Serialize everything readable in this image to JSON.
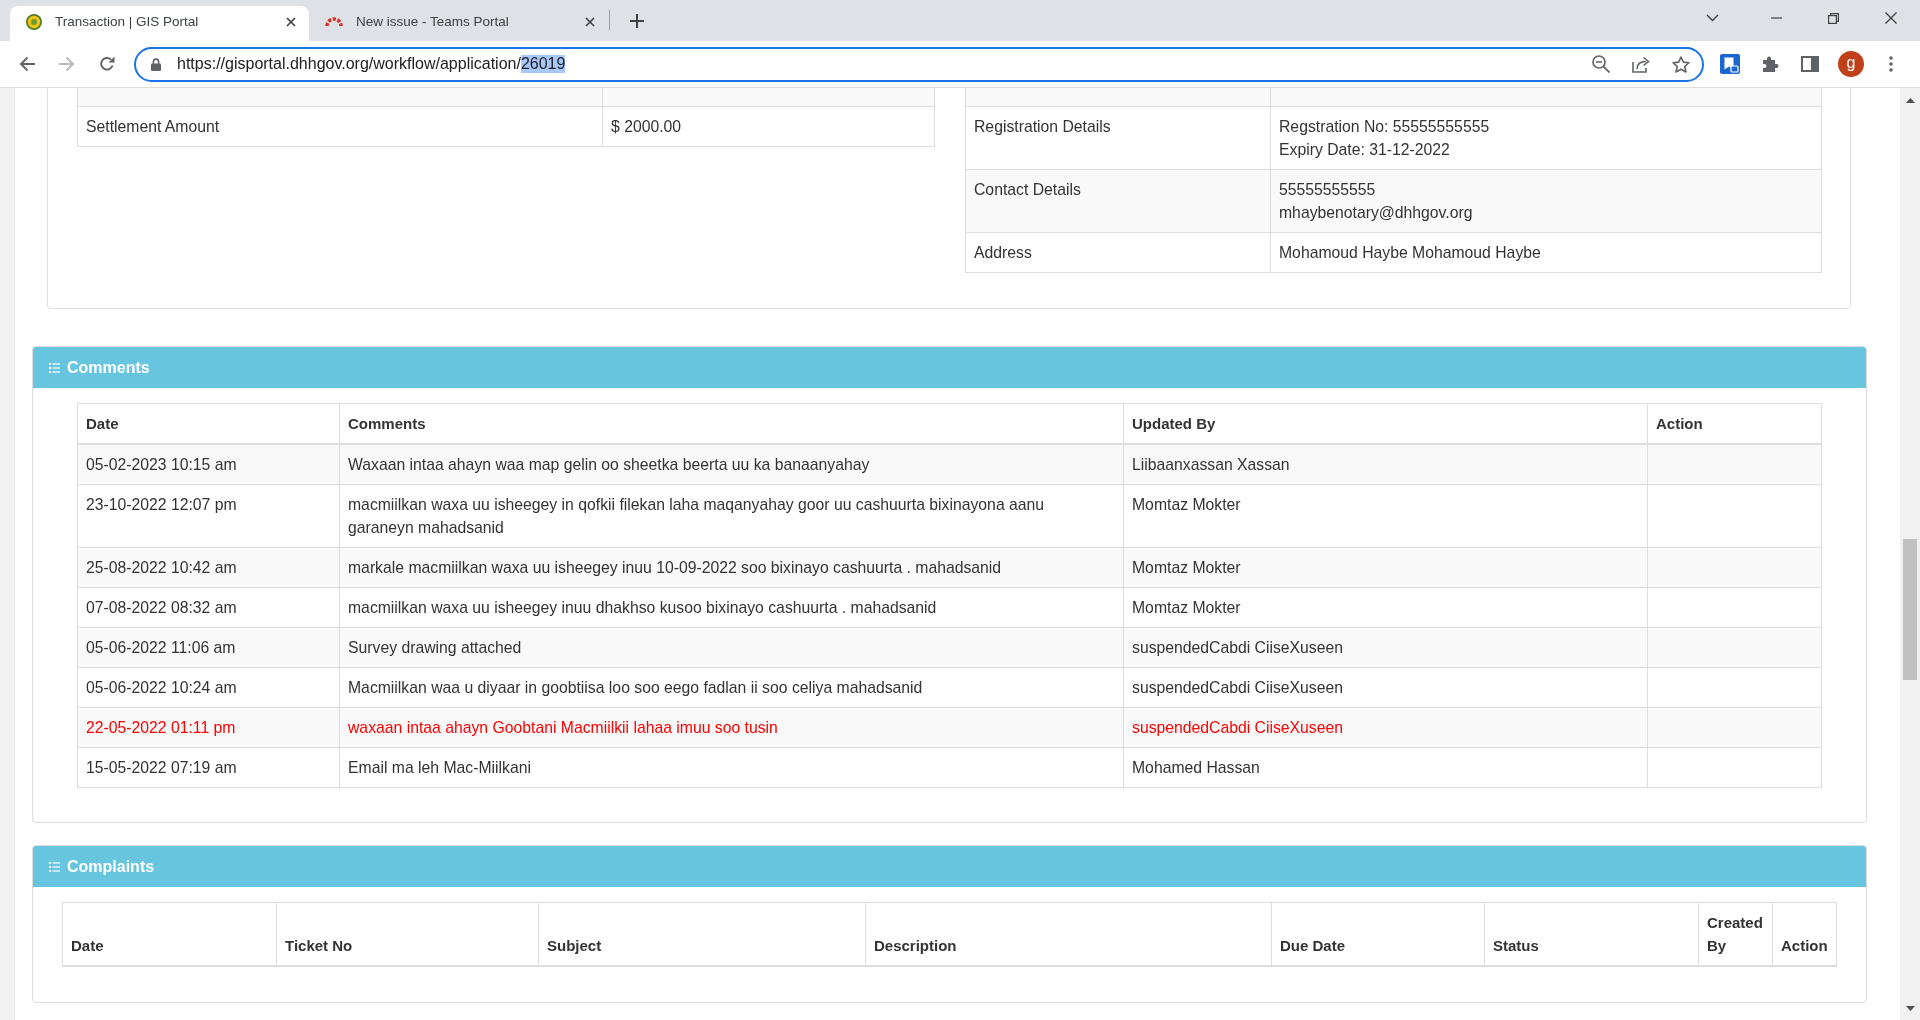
{
  "browser": {
    "tabs": [
      {
        "title": "Transaction | GIS Portal",
        "selected": true
      },
      {
        "title": "New issue - Teams Portal",
        "selected": false
      }
    ],
    "address_bar": {
      "url": [
        {
          "text": "https://gisportal.dhhgov.org/workflow/application/",
          "selected": false
        },
        {
          "text": "26019",
          "selected": true
        }
      ]
    },
    "profile": {
      "initial": "g"
    }
  },
  "details": {
    "left_table": [
      {
        "label": "Settlement Amount",
        "value": "$ 2000.00"
      }
    ],
    "right_table": [
      {
        "label": "Registration Details",
        "value": "Regstration No: 55555555555\nExpiry Date: 31-12-2022"
      },
      {
        "label": "Contact Details",
        "value": "55555555555\nmhaybenotary@dhhgov.org"
      },
      {
        "label": "Address",
        "value": "Mohamoud Haybe Mohamoud Haybe"
      }
    ]
  },
  "comments": {
    "title": "Comments",
    "columns": [
      "Date",
      "Comments",
      "Updated By",
      "Action"
    ],
    "rows": [
      {
        "date": "05-02-2023 10:15 am",
        "comment": "Waxaan intaa ahayn waa map gelin oo sheetka beerta uu ka banaanyahay",
        "updated_by": "Liibaanxassan Xassan",
        "flagged": false
      },
      {
        "date": "23-10-2022 12:07 pm",
        "comment": "macmiilkan waxa uu isheegey in qofkii filekan laha maqanyahay goor uu cashuurta bixinayona aanu garaneyn mahadsanid",
        "updated_by": "Momtaz Mokter",
        "flagged": false
      },
      {
        "date": "25-08-2022 10:42 am",
        "comment": "markale macmiilkan waxa uu isheegey inuu 10-09-2022 soo bixinayo cashuurta . mahadsanid",
        "updated_by": "Momtaz Mokter",
        "flagged": false
      },
      {
        "date": "07-08-2022 08:32 am",
        "comment": "macmiilkan waxa uu isheegey inuu dhakhso kusoo bixinayo cashuurta . mahadsanid",
        "updated_by": "Momtaz Mokter",
        "flagged": false
      },
      {
        "date": "05-06-2022 11:06 am",
        "comment": "Survey drawing attached",
        "updated_by": "suspendedCabdi CiiseXuseen",
        "flagged": false
      },
      {
        "date": "05-06-2022 10:24 am",
        "comment": "Macmiilkan waa u diyaar in goobtiisa loo soo eego fadlan ii soo celiya mahadsanid",
        "updated_by": "suspendedCabdi CiiseXuseen",
        "flagged": false
      },
      {
        "date": "22-05-2022 01:11 pm",
        "comment": "waxaan intaa ahayn Goobtani Macmiilkii lahaa imuu soo tusin",
        "updated_by": "suspendedCabdi CiiseXuseen",
        "flagged": true
      },
      {
        "date": "15-05-2022 07:19 am",
        "comment": "Email ma leh Mac-Miilkani",
        "updated_by": "Mohamed Hassan",
        "flagged": false
      }
    ]
  },
  "complaints": {
    "title": "Complaints",
    "columns": [
      "Date",
      "Ticket No",
      "Subject",
      "Description",
      "Due Date",
      "Status",
      "Created By",
      "Action"
    ]
  }
}
